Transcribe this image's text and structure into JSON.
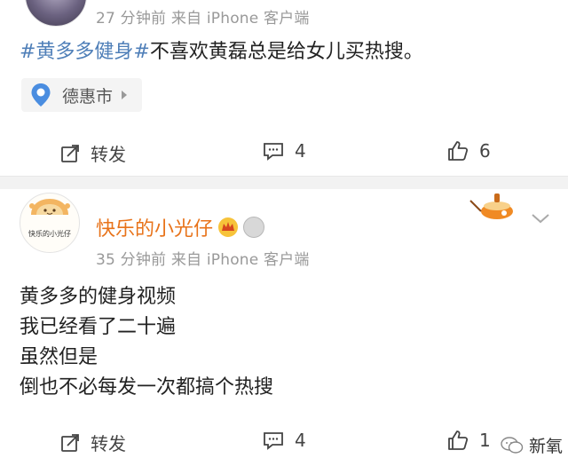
{
  "post1": {
    "meta": "27 分钟前  来自 iPhone 客户端",
    "hashtag": "#黄多多健身#",
    "text": "不喜欢黄磊总是给女儿买热搜。",
    "location": "德惠市",
    "actions": {
      "repost_label": "转发",
      "comment_count": "4",
      "like_count": "6"
    }
  },
  "post2": {
    "username": "快乐的小光仔",
    "avatar_text": "快乐的小光仔",
    "meta": "35 分钟前  来自 iPhone 客户端",
    "lines": [
      "黄多多的健身视频",
      "我已经看了二十遍",
      "虽然但是",
      "倒也不必每发一次都搞个热搜"
    ],
    "actions": {
      "repost_label": "转发",
      "comment_count": "4",
      "like_count": "1"
    }
  },
  "watermark": "新氧",
  "colors": {
    "hashtag": "#4f7fb8",
    "username": "#e8731a",
    "meta": "#999999",
    "divider": "#f2f2f2"
  }
}
